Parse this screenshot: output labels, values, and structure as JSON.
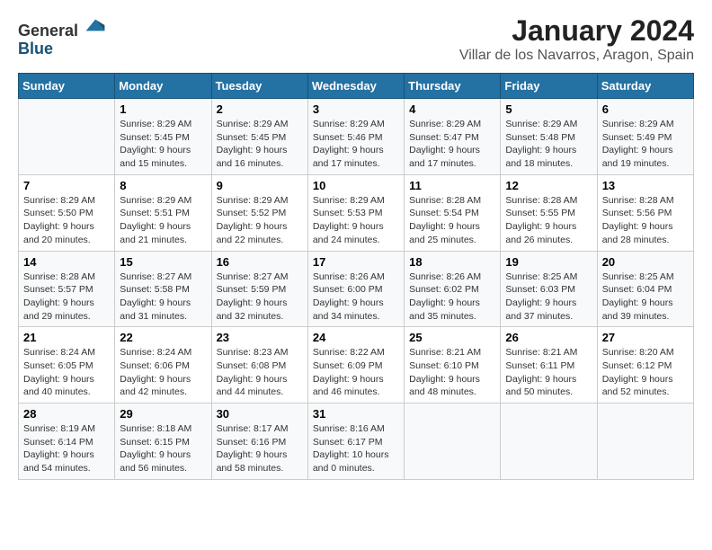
{
  "header": {
    "logo_general": "General",
    "logo_blue": "Blue",
    "title": "January 2024",
    "subtitle": "Villar de los Navarros, Aragon, Spain"
  },
  "days_of_week": [
    "Sunday",
    "Monday",
    "Tuesday",
    "Wednesday",
    "Thursday",
    "Friday",
    "Saturday"
  ],
  "weeks": [
    [
      {
        "day": "",
        "sunrise": "",
        "sunset": "",
        "daylight": ""
      },
      {
        "day": "1",
        "sunrise": "Sunrise: 8:29 AM",
        "sunset": "Sunset: 5:45 PM",
        "daylight": "Daylight: 9 hours and 15 minutes."
      },
      {
        "day": "2",
        "sunrise": "Sunrise: 8:29 AM",
        "sunset": "Sunset: 5:45 PM",
        "daylight": "Daylight: 9 hours and 16 minutes."
      },
      {
        "day": "3",
        "sunrise": "Sunrise: 8:29 AM",
        "sunset": "Sunset: 5:46 PM",
        "daylight": "Daylight: 9 hours and 17 minutes."
      },
      {
        "day": "4",
        "sunrise": "Sunrise: 8:29 AM",
        "sunset": "Sunset: 5:47 PM",
        "daylight": "Daylight: 9 hours and 17 minutes."
      },
      {
        "day": "5",
        "sunrise": "Sunrise: 8:29 AM",
        "sunset": "Sunset: 5:48 PM",
        "daylight": "Daylight: 9 hours and 18 minutes."
      },
      {
        "day": "6",
        "sunrise": "Sunrise: 8:29 AM",
        "sunset": "Sunset: 5:49 PM",
        "daylight": "Daylight: 9 hours and 19 minutes."
      }
    ],
    [
      {
        "day": "7",
        "sunrise": "Sunrise: 8:29 AM",
        "sunset": "Sunset: 5:50 PM",
        "daylight": "Daylight: 9 hours and 20 minutes."
      },
      {
        "day": "8",
        "sunrise": "Sunrise: 8:29 AM",
        "sunset": "Sunset: 5:51 PM",
        "daylight": "Daylight: 9 hours and 21 minutes."
      },
      {
        "day": "9",
        "sunrise": "Sunrise: 8:29 AM",
        "sunset": "Sunset: 5:52 PM",
        "daylight": "Daylight: 9 hours and 22 minutes."
      },
      {
        "day": "10",
        "sunrise": "Sunrise: 8:29 AM",
        "sunset": "Sunset: 5:53 PM",
        "daylight": "Daylight: 9 hours and 24 minutes."
      },
      {
        "day": "11",
        "sunrise": "Sunrise: 8:28 AM",
        "sunset": "Sunset: 5:54 PM",
        "daylight": "Daylight: 9 hours and 25 minutes."
      },
      {
        "day": "12",
        "sunrise": "Sunrise: 8:28 AM",
        "sunset": "Sunset: 5:55 PM",
        "daylight": "Daylight: 9 hours and 26 minutes."
      },
      {
        "day": "13",
        "sunrise": "Sunrise: 8:28 AM",
        "sunset": "Sunset: 5:56 PM",
        "daylight": "Daylight: 9 hours and 28 minutes."
      }
    ],
    [
      {
        "day": "14",
        "sunrise": "Sunrise: 8:28 AM",
        "sunset": "Sunset: 5:57 PM",
        "daylight": "Daylight: 9 hours and 29 minutes."
      },
      {
        "day": "15",
        "sunrise": "Sunrise: 8:27 AM",
        "sunset": "Sunset: 5:58 PM",
        "daylight": "Daylight: 9 hours and 31 minutes."
      },
      {
        "day": "16",
        "sunrise": "Sunrise: 8:27 AM",
        "sunset": "Sunset: 5:59 PM",
        "daylight": "Daylight: 9 hours and 32 minutes."
      },
      {
        "day": "17",
        "sunrise": "Sunrise: 8:26 AM",
        "sunset": "Sunset: 6:00 PM",
        "daylight": "Daylight: 9 hours and 34 minutes."
      },
      {
        "day": "18",
        "sunrise": "Sunrise: 8:26 AM",
        "sunset": "Sunset: 6:02 PM",
        "daylight": "Daylight: 9 hours and 35 minutes."
      },
      {
        "day": "19",
        "sunrise": "Sunrise: 8:25 AM",
        "sunset": "Sunset: 6:03 PM",
        "daylight": "Daylight: 9 hours and 37 minutes."
      },
      {
        "day": "20",
        "sunrise": "Sunrise: 8:25 AM",
        "sunset": "Sunset: 6:04 PM",
        "daylight": "Daylight: 9 hours and 39 minutes."
      }
    ],
    [
      {
        "day": "21",
        "sunrise": "Sunrise: 8:24 AM",
        "sunset": "Sunset: 6:05 PM",
        "daylight": "Daylight: 9 hours and 40 minutes."
      },
      {
        "day": "22",
        "sunrise": "Sunrise: 8:24 AM",
        "sunset": "Sunset: 6:06 PM",
        "daylight": "Daylight: 9 hours and 42 minutes."
      },
      {
        "day": "23",
        "sunrise": "Sunrise: 8:23 AM",
        "sunset": "Sunset: 6:08 PM",
        "daylight": "Daylight: 9 hours and 44 minutes."
      },
      {
        "day": "24",
        "sunrise": "Sunrise: 8:22 AM",
        "sunset": "Sunset: 6:09 PM",
        "daylight": "Daylight: 9 hours and 46 minutes."
      },
      {
        "day": "25",
        "sunrise": "Sunrise: 8:21 AM",
        "sunset": "Sunset: 6:10 PM",
        "daylight": "Daylight: 9 hours and 48 minutes."
      },
      {
        "day": "26",
        "sunrise": "Sunrise: 8:21 AM",
        "sunset": "Sunset: 6:11 PM",
        "daylight": "Daylight: 9 hours and 50 minutes."
      },
      {
        "day": "27",
        "sunrise": "Sunrise: 8:20 AM",
        "sunset": "Sunset: 6:12 PM",
        "daylight": "Daylight: 9 hours and 52 minutes."
      }
    ],
    [
      {
        "day": "28",
        "sunrise": "Sunrise: 8:19 AM",
        "sunset": "Sunset: 6:14 PM",
        "daylight": "Daylight: 9 hours and 54 minutes."
      },
      {
        "day": "29",
        "sunrise": "Sunrise: 8:18 AM",
        "sunset": "Sunset: 6:15 PM",
        "daylight": "Daylight: 9 hours and 56 minutes."
      },
      {
        "day": "30",
        "sunrise": "Sunrise: 8:17 AM",
        "sunset": "Sunset: 6:16 PM",
        "daylight": "Daylight: 9 hours and 58 minutes."
      },
      {
        "day": "31",
        "sunrise": "Sunrise: 8:16 AM",
        "sunset": "Sunset: 6:17 PM",
        "daylight": "Daylight: 10 hours and 0 minutes."
      },
      {
        "day": "",
        "sunrise": "",
        "sunset": "",
        "daylight": ""
      },
      {
        "day": "",
        "sunrise": "",
        "sunset": "",
        "daylight": ""
      },
      {
        "day": "",
        "sunrise": "",
        "sunset": "",
        "daylight": ""
      }
    ]
  ]
}
